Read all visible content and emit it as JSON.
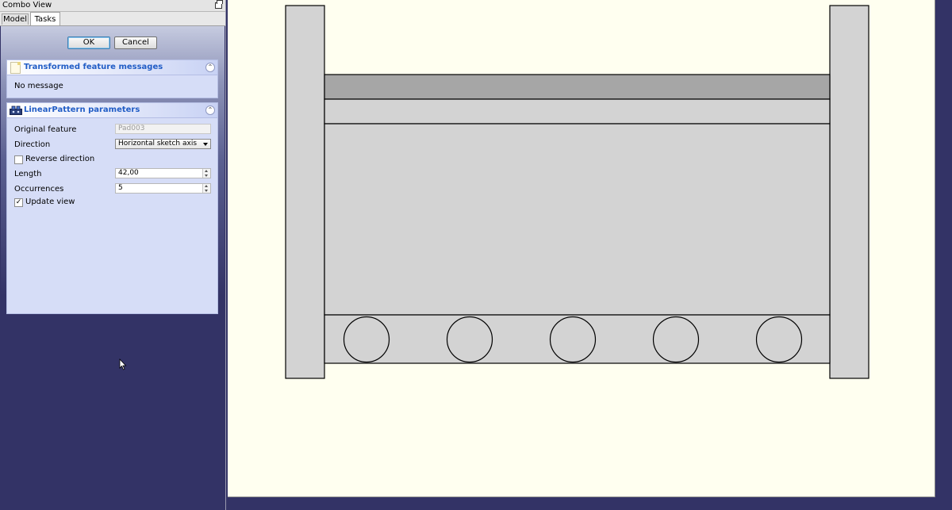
{
  "window": {
    "title": "Combo View"
  },
  "tabs": [
    {
      "label": "Model"
    },
    {
      "label": "Tasks"
    }
  ],
  "buttons": {
    "ok": "OK",
    "cancel": "Cancel"
  },
  "messages_box": {
    "title": "Transformed feature messages",
    "text": "No message",
    "icon": "document-icon"
  },
  "params_box": {
    "title": "LinearPattern parameters",
    "icon": "linear-pattern-icon",
    "original_feature": {
      "label": "Original feature",
      "value": "Pad003"
    },
    "direction": {
      "label": "Direction",
      "value": "Horizontal sketch axis"
    },
    "reverse_direction": {
      "label": "Reverse direction",
      "checked": false
    },
    "length": {
      "label": "Length",
      "value": "42,00"
    },
    "occurrences": {
      "label": "Occurrences",
      "value": "5"
    },
    "update_view": {
      "label": "Update view",
      "checked": true
    }
  },
  "colors": {
    "view_background": "#fffff0",
    "panel_background": "#333366",
    "part_fill": "#d3d3d3",
    "part_dark_fill": "#a6a6a6",
    "box_title": "#215dc6"
  },
  "drawing": {
    "pattern_holes": 5
  }
}
